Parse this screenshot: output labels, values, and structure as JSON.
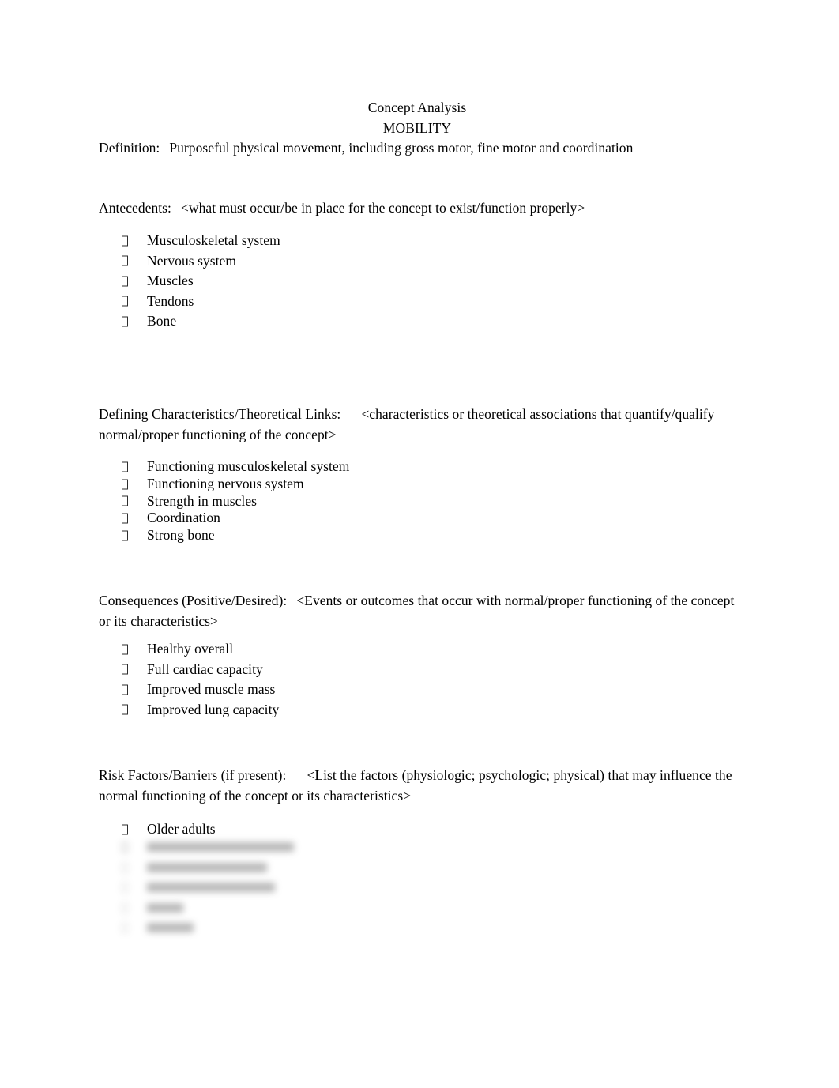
{
  "document": {
    "title_line_1": "Concept Analysis",
    "title_line_2": "MOBILITY",
    "definition_label": "Definition:",
    "definition_text": "Purposeful physical movement, including gross motor, fine motor and coordination"
  },
  "sections": {
    "antecedents": {
      "heading": "Antecedents:",
      "prompt": "<what must occur/be in place for the concept to exist/function properly>",
      "items": [
        "Musculoskeletal system",
        "Nervous system",
        "Muscles",
        "Tendons",
        "Bone"
      ]
    },
    "defining_characteristics": {
      "heading": "Defining Characteristics/Theoretical Links:",
      "prompt": "<characteristics or theoretical associations that quantify/qualify normal/proper functioning of the concept>",
      "items": [
        "Functioning musculoskeletal system",
        "Functioning nervous system",
        "Strength in muscles",
        "Coordination",
        "Strong bone"
      ]
    },
    "consequences": {
      "heading": "Consequences (Positive/Desired):",
      "prompt": "<Events or outcomes that occur with normal/proper functioning of the concept or its characteristics>",
      "items": [
        "Healthy overall",
        "Full cardiac capacity",
        "Improved muscle mass",
        "Improved lung capacity"
      ]
    },
    "risk_factors": {
      "heading": "Risk Factors/Barriers (if present):",
      "prompt": "<List the factors (physiologic; psychologic; physical) that may influence the normal functioning of the concept or its characteristics>",
      "items": [
        "Older adults"
      ],
      "redacted_item_count": 5
    }
  },
  "style": {
    "page_background": "#ffffff",
    "text_color": "#000000",
    "bullet_glyph": "missing-glyph-box"
  }
}
